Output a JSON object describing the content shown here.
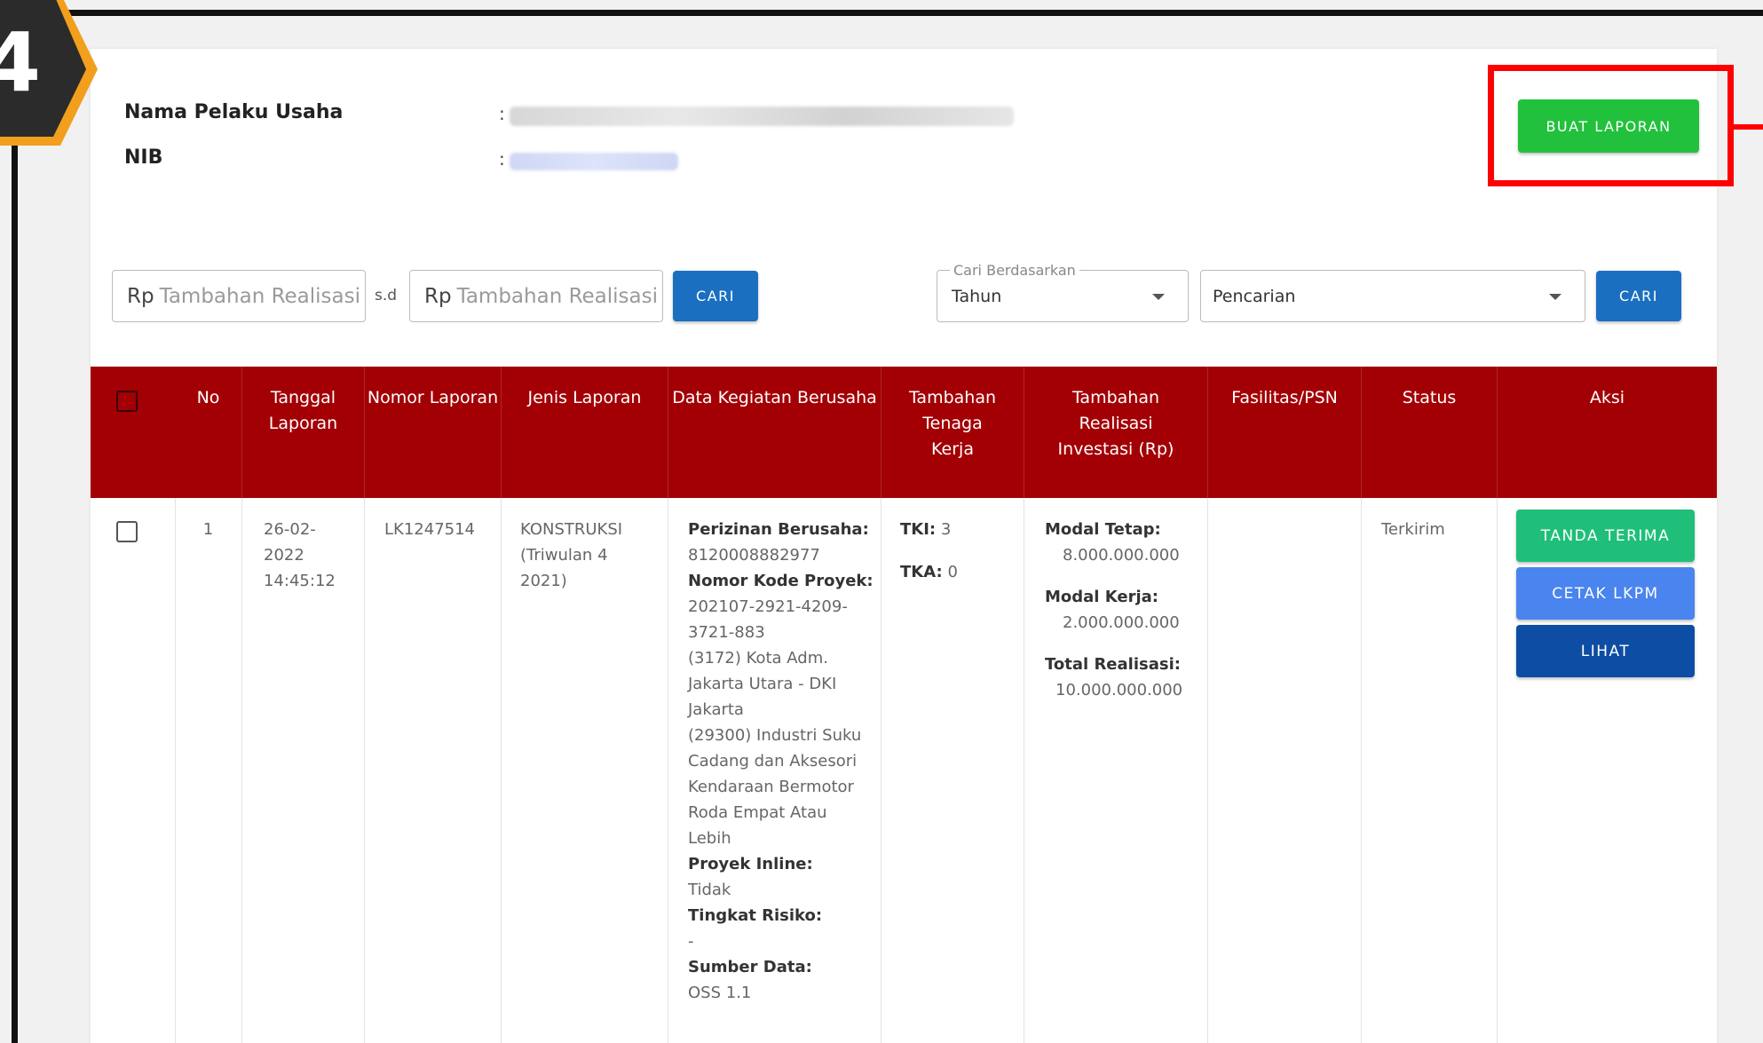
{
  "step": {
    "number": "4",
    "colors": {
      "badge": "#2b2b2b",
      "border": "#f29f1d"
    }
  },
  "header": {
    "business_name_label": "Nama Pelaku Usaha",
    "nib_label": "NIB",
    "colon": ":",
    "create_report_button": "BUAT LAPORAN"
  },
  "filters": {
    "currency_prefix": "Rp",
    "min_placeholder": "Tambahan Realisasi",
    "max_placeholder": "Tambahan Realisasi",
    "range_separator": "s.d",
    "search_button_1": "CARI",
    "search_by_legend": "Cari Berdasarkan",
    "search_by_value": "Tahun",
    "query_value": "Pencarian",
    "search_button_2": "CARI"
  },
  "table": {
    "columns": [
      "No",
      "Tanggal Laporan",
      "Nomor Laporan",
      "Jenis Laporan",
      "Data Kegiatan Berusaha",
      "Tambahan Tenaga Kerja",
      "Tambahan Realisasi Investasi (Rp)",
      "Fasilitas/PSN",
      "Status",
      "Aksi"
    ],
    "row": {
      "no": "1",
      "date": "26-02-2022 14:45:12",
      "report_no": "LK1247514",
      "report_type": "KONSTRUKSI (Triwulan 4 2021)",
      "activity": {
        "permit_label": "Perizinan Berusaha:",
        "permit_value": "8120008882977",
        "project_code_label": "Nomor Kode Proyek:",
        "project_code_value": "202107-2921-4209-3721-883",
        "location": "(3172) Kota Adm. Jakarta Utara - DKI Jakarta",
        "industry": "(29300) Industri Suku Cadang dan Aksesori Kendaraan Bermotor Roda Empat Atau Lebih",
        "inline_label": "Proyek Inline:",
        "inline_value": "Tidak",
        "risk_label": "Tingkat Risiko:",
        "risk_value": "-",
        "source_label": "Sumber Data:",
        "source_value": "OSS 1.1"
      },
      "workforce": {
        "tki_label": "TKI:",
        "tki_value": "3",
        "tka_label": "TKA:",
        "tka_value": "0"
      },
      "investment": {
        "fixed_label": "Modal Tetap:",
        "fixed_value": "8.000.000.000",
        "working_label": "Modal Kerja:",
        "working_value": "2.000.000.000",
        "total_label": "Total Realisasi:",
        "total_value": "10.000.000.000"
      },
      "facility": "",
      "status": "Terkirim",
      "actions": {
        "receipt": "TANDA TERIMA",
        "print": "CETAK LKPM",
        "view": "LIHAT"
      }
    }
  },
  "colors": {
    "table_header": "#a30005",
    "create_button": "#22c13d",
    "search_button": "#1b6fc0",
    "receipt_button": "#1fbf7a",
    "print_button": "#4a84ee",
    "view_button": "#0d4da3",
    "highlight": "#ff0000"
  }
}
